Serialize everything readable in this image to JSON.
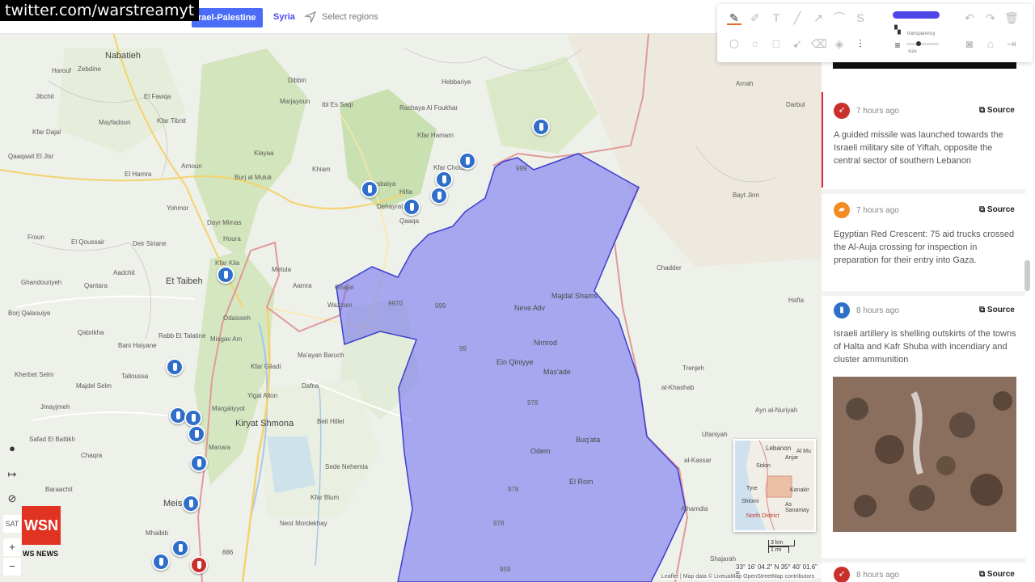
{
  "watermark": "twitter.com/warstreamyt",
  "tabs": [
    {
      "label": "rael-Palestine"
    },
    {
      "label": "Syria"
    }
  ],
  "select_regions": "Select regions",
  "toolbar": {
    "transparency_label": "transparency",
    "size_label": "size",
    "color": "#5046e8"
  },
  "map": {
    "places": [
      {
        "name": "Nabatieh"
      },
      {
        "name": "Harouf"
      },
      {
        "name": "Zebdine"
      },
      {
        "name": "Jibchit"
      },
      {
        "name": "Mayfadoun"
      },
      {
        "name": "Kfar Dajal"
      },
      {
        "name": "El Fawqa"
      },
      {
        "name": "Kfar Tibnit"
      },
      {
        "name": "Qaaqaait El Jisr"
      },
      {
        "name": "El Hamra"
      },
      {
        "name": "Arnoun"
      },
      {
        "name": "Yohmor"
      },
      {
        "name": "Froun"
      },
      {
        "name": "El Qoussair"
      },
      {
        "name": "Deir Siriane"
      },
      {
        "name": "Ghandouriyeh"
      },
      {
        "name": "Qantara"
      },
      {
        "name": "Aadchit"
      },
      {
        "name": "Et Taibeh"
      },
      {
        "name": "Borj Qalaouiye"
      },
      {
        "name": "Qabrikha"
      },
      {
        "name": "Rabb Et Talatine"
      },
      {
        "name": "Bani Haiyane"
      },
      {
        "name": "Talloussa"
      },
      {
        "name": "Kherbet Selm"
      },
      {
        "name": "Majdel Selm"
      },
      {
        "name": "Jmayjmeh"
      },
      {
        "name": "Safad El Battikh"
      },
      {
        "name": "Chaqra"
      },
      {
        "name": "Baraachit"
      },
      {
        "name": "Mhaibib"
      },
      {
        "name": "Meiss"
      },
      {
        "name": "Kiryat Shmona"
      },
      {
        "name": "Metula"
      },
      {
        "name": "Dayr Mimas"
      },
      {
        "name": "Houra"
      },
      {
        "name": "Kfar Kila"
      },
      {
        "name": "Odaisseh"
      },
      {
        "name": "Misgav Am"
      },
      {
        "name": "Kfar Giladi"
      },
      {
        "name": "Yigal Allon"
      },
      {
        "name": "Margaliyyot"
      },
      {
        "name": "Manara"
      },
      {
        "name": "Marjayoun"
      },
      {
        "name": "Ibl Es Saqi"
      },
      {
        "name": "Klayaa"
      },
      {
        "name": "Khiam"
      },
      {
        "name": "Burj al Muluk"
      },
      {
        "name": "Aamra"
      },
      {
        "name": "Ghajar"
      },
      {
        "name": "Wazzani"
      },
      {
        "name": "Dafna"
      },
      {
        "name": "Sede Nehemia"
      },
      {
        "name": "Kfar Blum"
      },
      {
        "name": "Neot Mordekhay"
      },
      {
        "name": "Beit Hillel"
      },
      {
        "name": "Ma'ayan Baruch"
      },
      {
        "name": "Hasbaiya"
      },
      {
        "name": "Kfar Chouba"
      },
      {
        "name": "Kfar Hamam"
      },
      {
        "name": "Rachaya Al Foukhar"
      },
      {
        "name": "Hebbariye"
      },
      {
        "name": "Dibbin"
      },
      {
        "name": "Dehayrat"
      },
      {
        "name": "Qaaqa"
      },
      {
        "name": "Hilta"
      },
      {
        "name": "Neve Ativ"
      },
      {
        "name": "Majdal Shams"
      },
      {
        "name": "Mas'ade"
      },
      {
        "name": "Ein Qiniyye"
      },
      {
        "name": "Nimrod"
      },
      {
        "name": "Buq'ata"
      },
      {
        "name": "Odem"
      },
      {
        "name": "El Rom"
      },
      {
        "name": "Arnah"
      },
      {
        "name": "Darbul"
      },
      {
        "name": "Bayt Jinn"
      },
      {
        "name": "Chadder"
      },
      {
        "name": "Hafta"
      },
      {
        "name": "Trenjeh"
      },
      {
        "name": "al-Khashab"
      },
      {
        "name": "Ayn al-Nuriyah"
      },
      {
        "name": "Ufaniyah"
      },
      {
        "name": "al-Kassar"
      },
      {
        "name": "Alhamdia"
      },
      {
        "name": "Shajarah"
      },
      {
        "name": "Kiryat Shmona"
      }
    ],
    "road_labels": [
      "999",
      "9970",
      "999",
      "99",
      "978",
      "978",
      "959",
      "886",
      "978"
    ]
  },
  "minimap": {
    "labels": [
      "Lebanon",
      "Sidon",
      "Tyre",
      "Shlomi",
      "North District",
      "Anjar",
      "Al Mu",
      "Kanakir",
      "As Sanamay"
    ]
  },
  "scale": {
    "km": "3 km",
    "mi": "1 mi"
  },
  "coords": "33° 16' 04.2\" N 35° 40' 01.6\" E",
  "attribution": "Leaflet | Map data © LiveuaMap OpenStreetMap contributors",
  "logo": {
    "top": "WSN",
    "bottom": "WS NEWS"
  },
  "controls": {
    "sat_label": "SAT"
  },
  "feed": {
    "entries": [
      {
        "time": "7 hours ago",
        "source": "Source",
        "text": "A guided missile was launched towards the Israeli military site of Yiftah, opposite the central sector of southern Lebanon",
        "color": "#c9302c"
      },
      {
        "time": "7 hours ago",
        "source": "Source",
        "text": "Egyptian Red Crescent: 75 aid trucks crossed the Al-Auja crossing for inspection in preparation for their entry into Gaza.",
        "color": "#f28b21"
      },
      {
        "time": "8 hours ago",
        "source": "Source",
        "text": "Israeli artillery is shelling outskirts of the towns of Halta and Kafr Shuba with incendiary and cluster ammunition",
        "color": "#2f6fc9"
      },
      {
        "time": "8 hours ago",
        "source": "Source",
        "text": "",
        "color": "#c9302c"
      }
    ]
  }
}
